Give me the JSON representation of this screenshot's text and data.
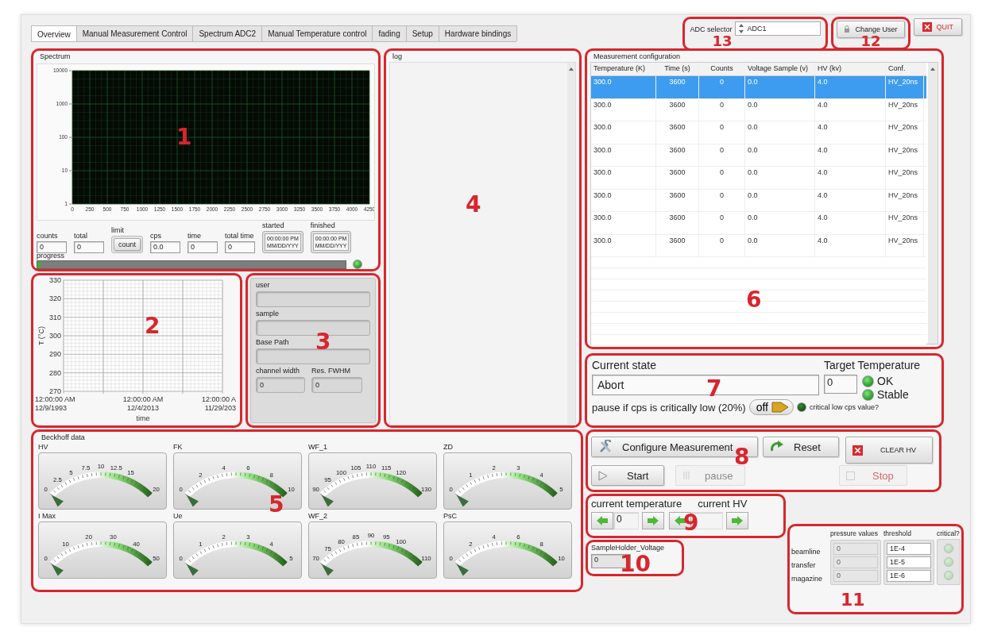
{
  "tabs": [
    {
      "label": "Overview",
      "selected": true
    },
    {
      "label": "Manual Measurement Control",
      "selected": false
    },
    {
      "label": "Spectrum ADC2",
      "selected": false
    },
    {
      "label": "Manual Temperature control",
      "selected": false
    },
    {
      "label": "fading",
      "selected": false
    },
    {
      "label": "Setup",
      "selected": false
    },
    {
      "label": "Hardware bindings",
      "selected": false
    }
  ],
  "adc_selector": {
    "label": "ADC selector",
    "value": "ADC1",
    "marker": "13"
  },
  "change_user": {
    "label": "Change User",
    "marker": "12"
  },
  "quit": {
    "label": "QUIT"
  },
  "spectrum": {
    "title": "Spectrum",
    "marker": "1",
    "axis": {
      "y_labels": [
        "10000",
        "1000",
        "100",
        "10",
        "1"
      ],
      "x_labels": [
        "0",
        "250",
        "500",
        "750",
        "1000",
        "1250",
        "1500",
        "1750",
        "2000",
        "2250",
        "2500",
        "2750",
        "3000",
        "3250",
        "3500",
        "3750",
        "4000",
        "4250"
      ]
    },
    "fields": [
      {
        "label": "counts",
        "value": "0",
        "kind": "text"
      },
      {
        "label": "total",
        "value": "0",
        "kind": "text"
      },
      {
        "label": "limit",
        "value": "count",
        "kind": "button"
      },
      {
        "label": "cps",
        "value": "0.0",
        "kind": "text"
      },
      {
        "label": "time",
        "value": "0",
        "kind": "text"
      },
      {
        "label": "total time",
        "value": "0",
        "kind": "text"
      },
      {
        "label": "started",
        "value": "00:00:00 PM\nMM/DD/YYY",
        "kind": "timestamp"
      },
      {
        "label": "finished",
        "value": "00:00:00 PM\nMM/DD/YYY",
        "kind": "timestamp"
      }
    ],
    "progress": {
      "label": "progress",
      "level": 0.01
    },
    "indicator": {
      "on": true
    }
  },
  "temperature_chart": {
    "marker": "2",
    "axis": {
      "xlabel": "time",
      "ylabel": "T (°C)",
      "y_labels": [
        "330",
        "320",
        "310",
        "300",
        "290",
        "280",
        "270"
      ],
      "x_labels": [
        "12:00:00 AM\n12/9/1993",
        "12:00:00 AM\n12/4/2013",
        "12:00:00 A\n11/29/203"
      ]
    }
  },
  "info": {
    "marker": "3",
    "fields": [
      {
        "label": "user",
        "kind": "wide"
      },
      {
        "label": "sample",
        "kind": "wide"
      },
      {
        "label": "Base Path",
        "kind": "wide"
      },
      {
        "label": "channel width",
        "value": "0",
        "kind": "half"
      },
      {
        "label": "Res. FWHM",
        "value": "0",
        "kind": "half"
      }
    ]
  },
  "log": {
    "title": "log",
    "marker": "4"
  },
  "beckhoff": {
    "title": "Beckhoff data",
    "marker": "5",
    "gauges": [
      {
        "label": "HV",
        "ticks": [
          "0",
          "2.5",
          "5",
          "7.5",
          "10",
          "12.5",
          "15",
          "20"
        ]
      },
      {
        "label": "FK",
        "ticks": [
          "0",
          "2",
          "4",
          "6",
          "8",
          "10"
        ]
      },
      {
        "label": "WF_1",
        "ticks": [
          "90",
          "95",
          "100",
          "105",
          "110",
          "115",
          "120",
          "130"
        ]
      },
      {
        "label": "ZD",
        "ticks": [
          "0",
          "1",
          "2",
          "3",
          "4",
          "5"
        ]
      },
      {
        "label": "I Max",
        "ticks": [
          "0",
          "10",
          "20",
          "30",
          "40",
          "50"
        ]
      },
      {
        "label": "Ue",
        "ticks": [
          "0",
          "1",
          "2",
          "3",
          "4",
          "5"
        ]
      },
      {
        "label": "WF_2",
        "ticks": [
          "70",
          "75",
          "80",
          "85",
          "90",
          "95",
          "100",
          "110"
        ]
      },
      {
        "label": "PsC",
        "ticks": [
          "0",
          "2",
          "4",
          "6",
          "8",
          "10"
        ]
      }
    ]
  },
  "config": {
    "title": "Measurement configuration",
    "marker": "6",
    "columns": [
      "Temperature (K)",
      "Time (s)",
      "Counts",
      "Voltage Sample (v)",
      "HV (kv)",
      "Conf."
    ],
    "rows": [
      {
        "cells": [
          "300.0",
          "3600",
          "0",
          "0.0",
          "4.0",
          "HV_20ns"
        ],
        "selected": true
      },
      {
        "cells": [
          "300.0",
          "3600",
          "0",
          "0.0",
          "4.0",
          "HV_20ns"
        ],
        "selected": false
      },
      {
        "cells": [
          "300.0",
          "3600",
          "0",
          "0.0",
          "4.0",
          "HV_20ns"
        ],
        "selected": false
      },
      {
        "cells": [
          "300.0",
          "3600",
          "0",
          "0.0",
          "4.0",
          "HV_20ns"
        ],
        "selected": false
      },
      {
        "cells": [
          "300.0",
          "3600",
          "0",
          "0.0",
          "4.0",
          "HV_20ns"
        ],
        "selected": false
      },
      {
        "cells": [
          "300.0",
          "3600",
          "0",
          "0.0",
          "4.0",
          "HV_20ns"
        ],
        "selected": false
      },
      {
        "cells": [
          "300.0",
          "3600",
          "0",
          "0.0",
          "4.0",
          "HV_20ns"
        ],
        "selected": false
      },
      {
        "cells": [
          "300.0",
          "3600",
          "0",
          "0.0",
          "4.0",
          "HV_20ns"
        ],
        "selected": false
      }
    ]
  },
  "state": {
    "marker": "7",
    "current_state": {
      "label": "Current state",
      "value": "Abort"
    },
    "target": {
      "label": "Target Temperature",
      "value": "0"
    },
    "leds": [
      {
        "label": "OK",
        "on": true
      },
      {
        "label": "Stable",
        "on": true
      }
    ],
    "pause_toggle": {
      "label": "pause if cps is critically low (20%)",
      "state_label": "off",
      "on": false
    },
    "critical_led": {
      "label": "critical low cps value?",
      "on": false
    }
  },
  "controls": {
    "marker": "8",
    "buttons": [
      {
        "label": "Configure Measurement",
        "kind": "configure",
        "disabled": false
      },
      {
        "label": "Reset",
        "kind": "reset",
        "disabled": false
      },
      {
        "label": "CLEAR HV",
        "kind": "clear",
        "disabled": false
      },
      {
        "label": "Start",
        "kind": "start",
        "disabled": false
      },
      {
        "label": "pause",
        "kind": "pause",
        "disabled": true
      },
      {
        "label": "Stop",
        "kind": "stop",
        "disabled": true
      }
    ]
  },
  "current": {
    "marker": "9",
    "temperature": {
      "label": "current temperature",
      "value": "0"
    },
    "hv": {
      "label": "current HV"
    }
  },
  "sample_holder": {
    "marker": "10",
    "label": "SampleHolder_Voltage",
    "value": "0"
  },
  "pressure": {
    "marker": "11",
    "headers": [
      "pressure values",
      "threshold",
      "critical?"
    ],
    "rows": [
      {
        "name": "beamline",
        "value": "0",
        "threshold": "1E-4",
        "critical": false,
        "disabled": true
      },
      {
        "name": "transfer",
        "value": "0",
        "threshold": "1E-5",
        "critical": false,
        "disabled": true
      },
      {
        "name": "magazine",
        "value": "0",
        "threshold": "1E-6",
        "critical": false,
        "disabled": true
      }
    ]
  }
}
